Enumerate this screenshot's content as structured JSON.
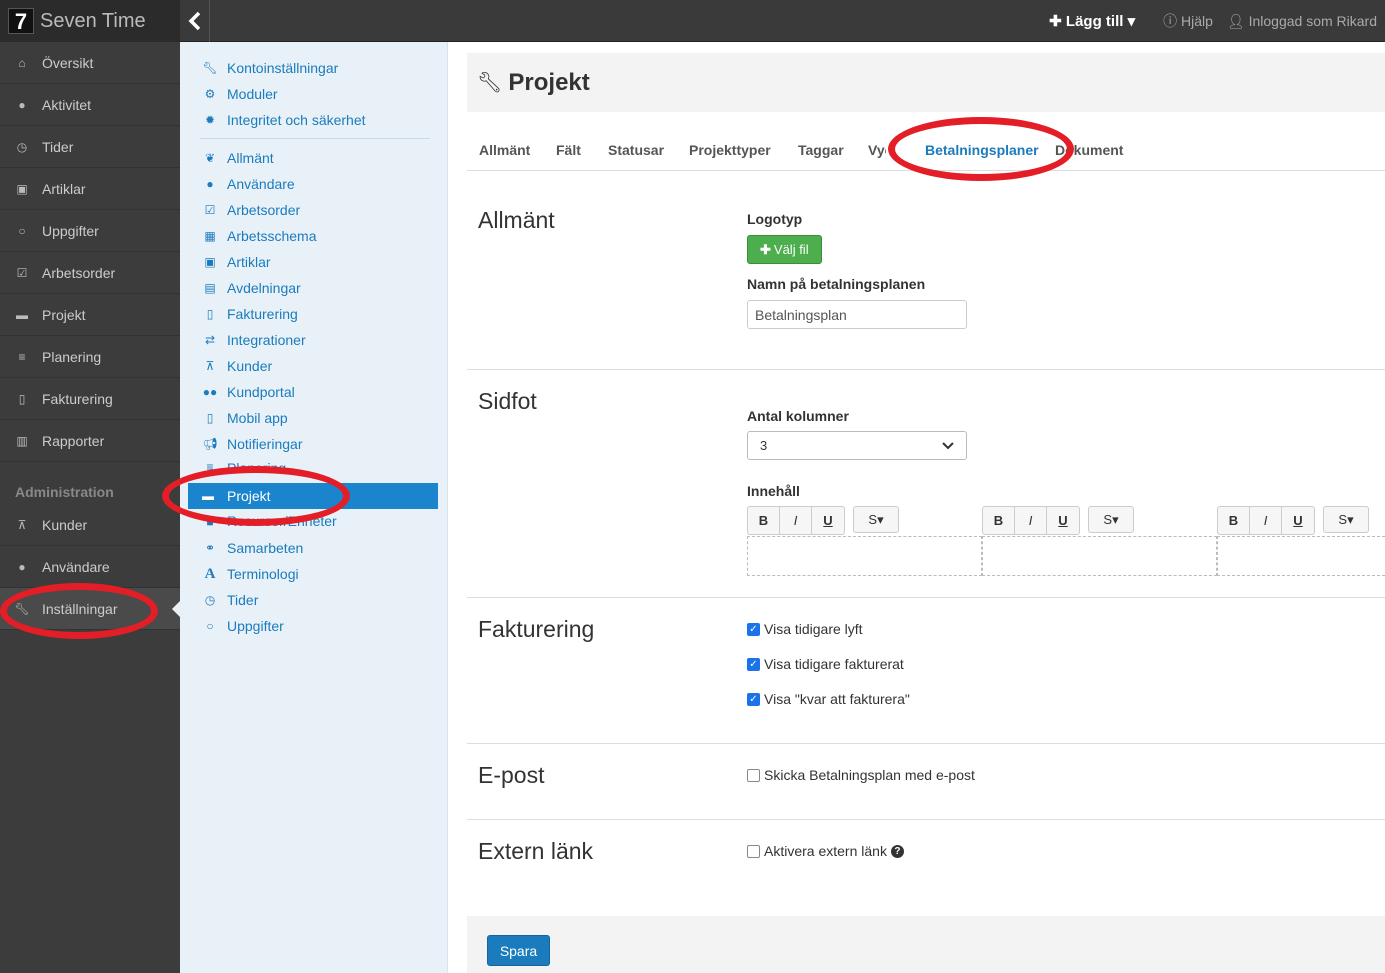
{
  "brand": {
    "logo": "7",
    "name": "Seven Time"
  },
  "topbar": {
    "collapse_icon": "‹",
    "add_label": "Lägg till",
    "help_label": "Hjälp",
    "user_label": "Inloggad som Rikard"
  },
  "leftnav": {
    "items": [
      {
        "label": "Översikt",
        "icon": "home-icon"
      },
      {
        "label": "Aktivitet",
        "icon": "map-marker-icon"
      },
      {
        "label": "Tider",
        "icon": "clock-icon"
      },
      {
        "label": "Artiklar",
        "icon": "money-icon"
      },
      {
        "label": "Uppgifter",
        "icon": "circle-icon"
      },
      {
        "label": "Arbetsorder",
        "icon": "check-square-icon"
      },
      {
        "label": "Projekt",
        "icon": "briefcase-icon"
      },
      {
        "label": "Planering",
        "icon": "align-left-icon"
      },
      {
        "label": "Fakturering",
        "icon": "file-icon"
      },
      {
        "label": "Rapporter",
        "icon": "bar-chart-icon"
      }
    ],
    "section": "Administration",
    "admin_items": [
      {
        "label": "Kunder",
        "icon": "sitemap-icon"
      },
      {
        "label": "Användare",
        "icon": "user-icon"
      },
      {
        "label": "Inställningar",
        "icon": "wrench-icon"
      }
    ]
  },
  "subnav": {
    "group1": [
      {
        "label": "Kontoinställningar",
        "icon": "wrench-icon"
      },
      {
        "label": "Moduler",
        "icon": "cogs-icon"
      },
      {
        "label": "Integritet och säkerhet",
        "icon": "certificate-icon"
      }
    ],
    "group2": [
      {
        "label": "Allmänt",
        "icon": "leaf-icon"
      },
      {
        "label": "Användare",
        "icon": "user-icon"
      },
      {
        "label": "Arbetsorder",
        "icon": "check-square-icon"
      },
      {
        "label": "Arbetsschema",
        "icon": "calendar-icon"
      },
      {
        "label": "Artiklar",
        "icon": "money-icon"
      },
      {
        "label": "Avdelningar",
        "icon": "building-icon"
      },
      {
        "label": "Fakturering",
        "icon": "file-icon"
      },
      {
        "label": "Integrationer",
        "icon": "exchange-icon"
      },
      {
        "label": "Kunder",
        "icon": "sitemap-icon"
      },
      {
        "label": "Kundportal",
        "icon": "users-icon"
      },
      {
        "label": "Mobil app",
        "icon": "mobile-icon"
      },
      {
        "label": "Notifieringar",
        "icon": "bullhorn-icon"
      },
      {
        "label": "Planering",
        "icon": "align-left-icon"
      }
    ],
    "active": {
      "label": "Projekt",
      "icon": "briefcase-icon"
    },
    "after_active_partial": "Resurser/Enheter",
    "group3": [
      {
        "label": "Samarbeten",
        "icon": "handshake-icon"
      },
      {
        "label": "Terminologi",
        "icon": "font-icon"
      },
      {
        "label": "Tider",
        "icon": "clock-icon"
      },
      {
        "label": "Uppgifter",
        "icon": "circle-icon"
      }
    ]
  },
  "page": {
    "title": "Projekt"
  },
  "tabs": [
    {
      "label": "Allmänt"
    },
    {
      "label": "Fält"
    },
    {
      "label": "Statusar"
    },
    {
      "label": "Projekttyper"
    },
    {
      "label": "Taggar"
    },
    {
      "label": "Vyer"
    },
    {
      "label": "Betalningsplaner"
    },
    {
      "label": "Dokument"
    }
  ],
  "sections": {
    "allmant": {
      "title": "Allmänt",
      "logo_label": "Logotyp",
      "file_button": "Välj fil",
      "name_label": "Namn på betalningsplanen",
      "name_value": "Betalningsplan"
    },
    "sidfot": {
      "title": "Sidfot",
      "columns_label": "Antal kolumner",
      "columns_value": "3",
      "content_label": "Innehåll",
      "bold": "B",
      "italic": "I",
      "underline": "U",
      "style": "S"
    },
    "fakturering": {
      "title": "Fakturering",
      "checks": [
        {
          "label": "Visa tidigare lyft",
          "checked": true
        },
        {
          "label": "Visa tidigare fakturerat",
          "checked": true
        },
        {
          "label": "Visa \"kvar att fakturera\"",
          "checked": true
        }
      ]
    },
    "epost": {
      "title": "E-post",
      "check_label": "Skicka Betalningsplan med e-post"
    },
    "extern": {
      "title": "Extern länk",
      "check_label": "Aktivera extern länk"
    }
  },
  "footer": {
    "save_label": "Spara"
  },
  "colors": {
    "accent": "#1a7bbd",
    "highlight": "#e41e26",
    "success": "#4cae4c"
  }
}
